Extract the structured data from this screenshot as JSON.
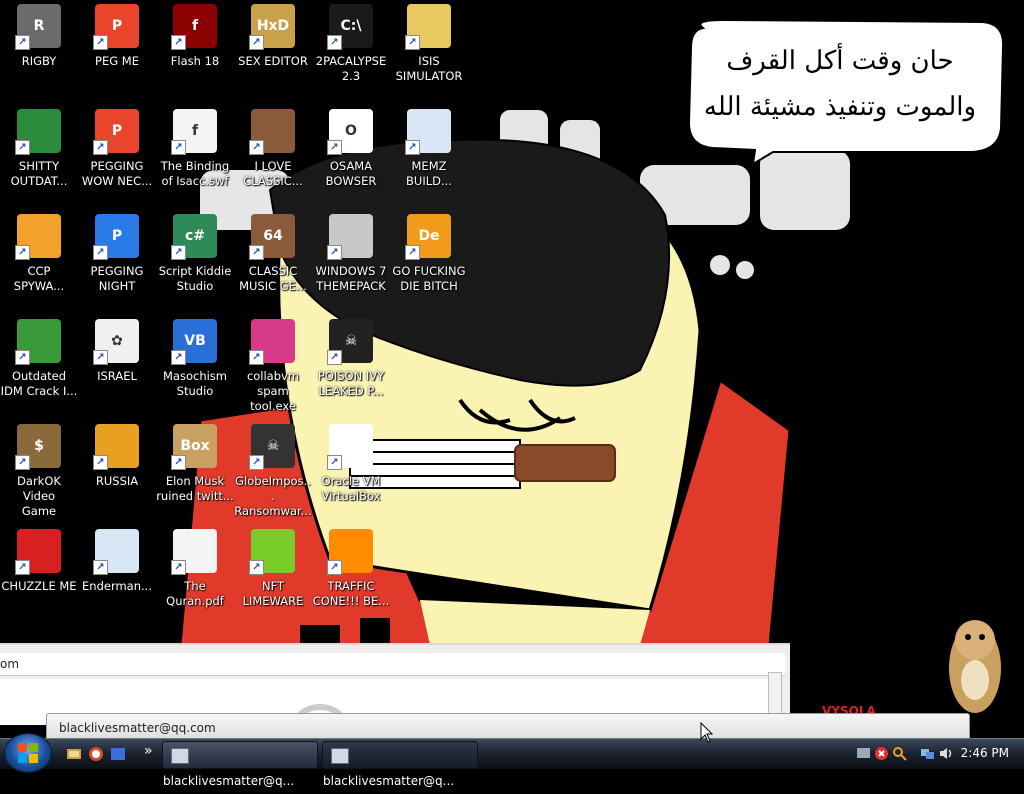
{
  "speech_bubble": {
    "line1": "حان وقت أكل القرف",
    "line2": "والموت وتنفيذ مشيئة الله"
  },
  "desktop_icons": [
    {
      "label_1": "RIGBY",
      "label_2": "",
      "icon": "raccoon-icon",
      "color": "#6b6b6b",
      "glyph": "R",
      "col": 0,
      "row": 0
    },
    {
      "label_1": "PEG ME",
      "label_2": "",
      "icon": "peggle-icon",
      "color": "#e8452a",
      "glyph": "P",
      "col": 1,
      "row": 0
    },
    {
      "label_1": "Flash 18",
      "label_2": "",
      "icon": "flash-icon",
      "color": "#8b0000",
      "glyph": "f",
      "col": 2,
      "row": 0
    },
    {
      "label_1": "SEX EDITOR",
      "label_2": "",
      "icon": "hxd-icon",
      "color": "#c8a14a",
      "glyph": "HxD",
      "col": 3,
      "row": 0
    },
    {
      "label_1": "2PACALYPSE",
      "label_2": "2.3",
      "icon": "terminal-icon",
      "color": "#1a1a1a",
      "glyph": "C:\\",
      "col": 4,
      "row": 0
    },
    {
      "label_1": "ISIS",
      "label_2": "SIMULATOR",
      "icon": "folder-icon",
      "color": "#e8c860",
      "glyph": "",
      "col": 5,
      "row": 0
    },
    {
      "label_1": "SHITTY",
      "label_2": "OUTDAT...",
      "icon": "chrome-icon",
      "color": "#2a8c3a",
      "glyph": "",
      "col": 0,
      "row": 1
    },
    {
      "label_1": "PEGGING",
      "label_2": "WOW NEC...",
      "icon": "peggle-icon",
      "color": "#e8452a",
      "glyph": "P",
      "col": 1,
      "row": 1
    },
    {
      "label_1": "The Binding",
      "label_2": "of Isacc.swf",
      "icon": "flash-file-icon",
      "color": "#f4f4f4",
      "glyph": "f",
      "col": 2,
      "row": 1
    },
    {
      "label_1": "I LOVE",
      "label_2": "CLASSIC...",
      "icon": "portrait-icon",
      "color": "#8a5a3a",
      "glyph": "",
      "col": 3,
      "row": 1
    },
    {
      "label_1": "OSAMA",
      "label_2": "BOWSER",
      "icon": "obama-logo-icon",
      "color": "#ffffff",
      "glyph": "O",
      "col": 4,
      "row": 1
    },
    {
      "label_1": "MEMZ",
      "label_2": "BUILD...",
      "icon": "window-app-icon",
      "color": "#d8e6f5",
      "glyph": "",
      "col": 5,
      "row": 1
    },
    {
      "label_1": "CCP",
      "label_2": "SPYWA...",
      "icon": "pinwheel-icon",
      "color": "#f2a12b",
      "glyph": "",
      "col": 0,
      "row": 2
    },
    {
      "label_1": "PEGGING",
      "label_2": "NIGHT",
      "icon": "peggle-icon",
      "color": "#2a7ae8",
      "glyph": "P",
      "col": 1,
      "row": 2
    },
    {
      "label_1": "Script Kiddie",
      "label_2": "Studio",
      "icon": "csharp-icon",
      "color": "#2e8b57",
      "glyph": "c#",
      "col": 2,
      "row": 2
    },
    {
      "label_1": "CLASSIC",
      "label_2": "MUSIC GE...",
      "icon": "portrait-64-icon",
      "color": "#8a5a3a",
      "glyph": "64",
      "col": 3,
      "row": 2
    },
    {
      "label_1": "WINDOWS 7",
      "label_2": "THEMEPACK",
      "icon": "server-icon",
      "color": "#c8c8c8",
      "glyph": "",
      "col": 4,
      "row": 2
    },
    {
      "label_1": "GO FUCKING",
      "label_2": "DIE BITCH",
      "icon": "de-icon",
      "color": "#f29b1a",
      "glyph": "De",
      "col": 5,
      "row": 2
    },
    {
      "label_1": "Outdated",
      "label_2": "IDM Crack I...",
      "icon": "globe-download-icon",
      "color": "#3a9a3a",
      "glyph": "",
      "col": 0,
      "row": 3
    },
    {
      "label_1": "ISRAEL",
      "label_2": "",
      "icon": "flower-icon",
      "color": "#f0f0f0",
      "glyph": "✿",
      "col": 1,
      "row": 3
    },
    {
      "label_1": "Masochism",
      "label_2": "Studio",
      "icon": "vb-icon",
      "color": "#2a6fd8",
      "glyph": "VB",
      "col": 2,
      "row": 3
    },
    {
      "label_1": "collabvm",
      "label_2": "spam tool.exe",
      "icon": "monitor-icon",
      "color": "#d83a8a",
      "glyph": "",
      "col": 3,
      "row": 3
    },
    {
      "label_1": "POISON IVY",
      "label_2": "LEAKED P...",
      "icon": "skull-icon",
      "color": "#222222",
      "glyph": "☠",
      "col": 4,
      "row": 3
    },
    {
      "label_1": "DarkOK Video",
      "label_2": "Game",
      "icon": "money-bag-icon",
      "color": "#8a6a3a",
      "glyph": "$",
      "col": 0,
      "row": 4
    },
    {
      "label_1": "RUSSIA",
      "label_2": "",
      "icon": "cube-icon",
      "color": "#e8a020",
      "glyph": "",
      "col": 1,
      "row": 4
    },
    {
      "label_1": "Elon Musk",
      "label_2": "ruined twitt...",
      "icon": "doge-box-icon",
      "color": "#c8a060",
      "glyph": "Box",
      "col": 2,
      "row": 4
    },
    {
      "label_1": "GlobeImpos...",
      "label_2": "Ransomwar...",
      "icon": "skull-eyes-icon",
      "color": "#333333",
      "glyph": "☠",
      "col": 3,
      "row": 4
    },
    {
      "label_1": "Oracle VM",
      "label_2": "VirtualBox",
      "icon": "windows-logo-icon",
      "color": "#ffffff",
      "glyph": "",
      "col": 4,
      "row": 4
    },
    {
      "label_1": "CHUZZLE ME",
      "label_2": "",
      "icon": "chuzzle-icon",
      "color": "#d82020",
      "glyph": "",
      "col": 0,
      "row": 5
    },
    {
      "label_1": "Enderman...",
      "label_2": "",
      "icon": "window-app-icon",
      "color": "#d8e6f5",
      "glyph": "",
      "col": 1,
      "row": 5
    },
    {
      "label_1": "The",
      "label_2": "Quran.pdf",
      "icon": "raccoon-file-icon",
      "color": "#f4f4f4",
      "glyph": "",
      "col": 2,
      "row": 5
    },
    {
      "label_1": "NFT",
      "label_2": "LIMEWARE",
      "icon": "limewire-icon",
      "color": "#7acc2a",
      "glyph": "",
      "col": 3,
      "row": 5
    },
    {
      "label_1": "TRAFFIC",
      "label_2": "CONE!!! BE...",
      "icon": "vlc-cone-icon",
      "color": "#ff8c00",
      "glyph": "",
      "col": 4,
      "row": 5
    }
  ],
  "window_back": {
    "address_text": "om"
  },
  "window_front": {
    "address_text": "blacklivesmatter@qq.com"
  },
  "taskbar": {
    "buttons": [
      {
        "label": "blacklivesmatter@q..."
      },
      {
        "label": "blacklivesmatter@q..."
      }
    ],
    "overflow_label": "»",
    "clock": "2:46 PM"
  },
  "colors": {
    "taskbar_dark": "#0b0f16",
    "bubble_fill": "#ffffff",
    "shirt_red": "#e23a2a",
    "skin": "#fbf3b2"
  }
}
